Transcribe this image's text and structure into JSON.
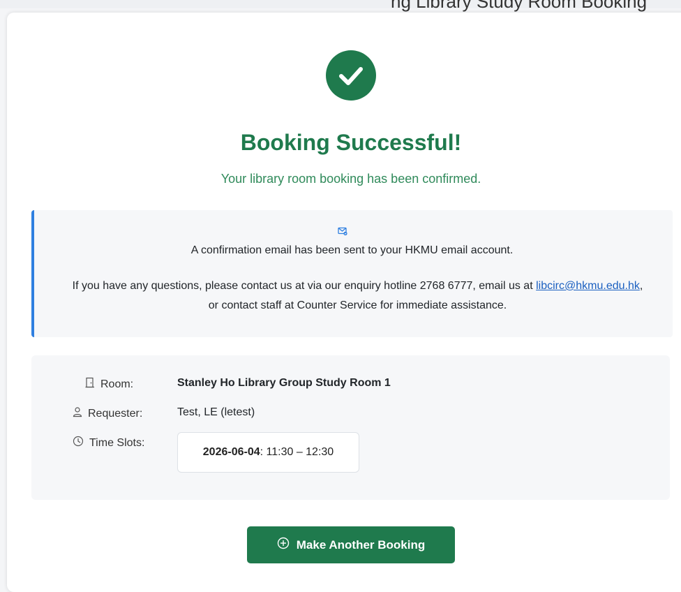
{
  "header_partial": "ng Library Study Room Booking",
  "status": {
    "title": "Booking Successful!",
    "subtitle": "Your library room booking has been confirmed."
  },
  "notice": {
    "email_sent": "A confirmation email has been sent to your HKMU email account.",
    "contact_prefix": "If you have any questions, please contact us at via our enquiry hotline 2768 6777, email us at",
    "contact_email": "libcirc@hkmu.edu.hk",
    "contact_suffix": ", or contact staff at Counter Service for immediate assistance."
  },
  "details": {
    "room_label": "Room:",
    "room_value": "Stanley Ho Library Group Study Room 1",
    "requester_label": "Requester:",
    "requester_value": "Test, LE (letest)",
    "slots_label": "Time Slots:",
    "slots": [
      {
        "date": "2026-06-04",
        "time": "11:30 – 12:30"
      }
    ]
  },
  "actions": {
    "make_another_label": "Make Another Booking"
  },
  "colors": {
    "success_green": "#1f7a4d",
    "accent_blue": "#2f7fe0"
  }
}
